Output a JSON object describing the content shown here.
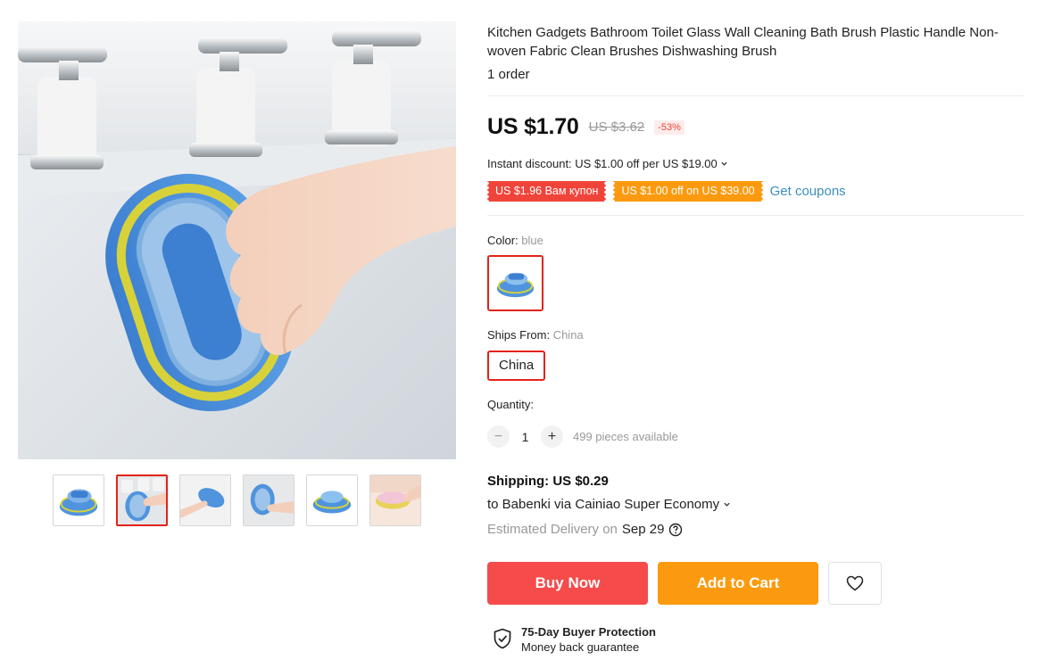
{
  "product": {
    "title": "Kitchen Gadgets Bathroom Toilet Glass Wall Cleaning Bath Brush Plastic Handle Non-woven Fabric Clean Brushes Dishwashing Brush",
    "orders": "1 order"
  },
  "gallery": {
    "thumbnails": [
      "thumb-1",
      "thumb-2",
      "thumb-3",
      "thumb-4",
      "thumb-5",
      "thumb-6"
    ],
    "active_index": 1
  },
  "price": {
    "current": "US $1.70",
    "original": "US $3.62",
    "discount": "-53%",
    "instant_discount": "Instant discount: US $1.00 off per US $19.00"
  },
  "coupons": {
    "red": "US $1.96 Вам купон",
    "orange": "US $1.00 off on US $39.00",
    "get_coupons": "Get coupons"
  },
  "color": {
    "label": "Color: ",
    "value": "blue"
  },
  "ships_from": {
    "label": "Ships From: ",
    "value": "China",
    "option": "China"
  },
  "quantity": {
    "label": "Quantity:",
    "minus": "−",
    "value": "1",
    "plus": "+",
    "available": "499 pieces available"
  },
  "shipping": {
    "cost": "Shipping: US $0.29",
    "to": "to Babenki via Cainiao Super Economy",
    "estimated_label": "Estimated Delivery on",
    "estimated_date": "Sep 29"
  },
  "actions": {
    "buy_now": "Buy Now",
    "add_to_cart": "Add to Cart"
  },
  "protection": {
    "title": "75-Day Buyer Protection",
    "subtitle": "Money back guarantee"
  },
  "colors": {
    "accent_red": "#f54b4b",
    "accent_orange": "#fb9a0e",
    "link_blue": "#3a8fbd",
    "selected_border": "#e2231a"
  }
}
